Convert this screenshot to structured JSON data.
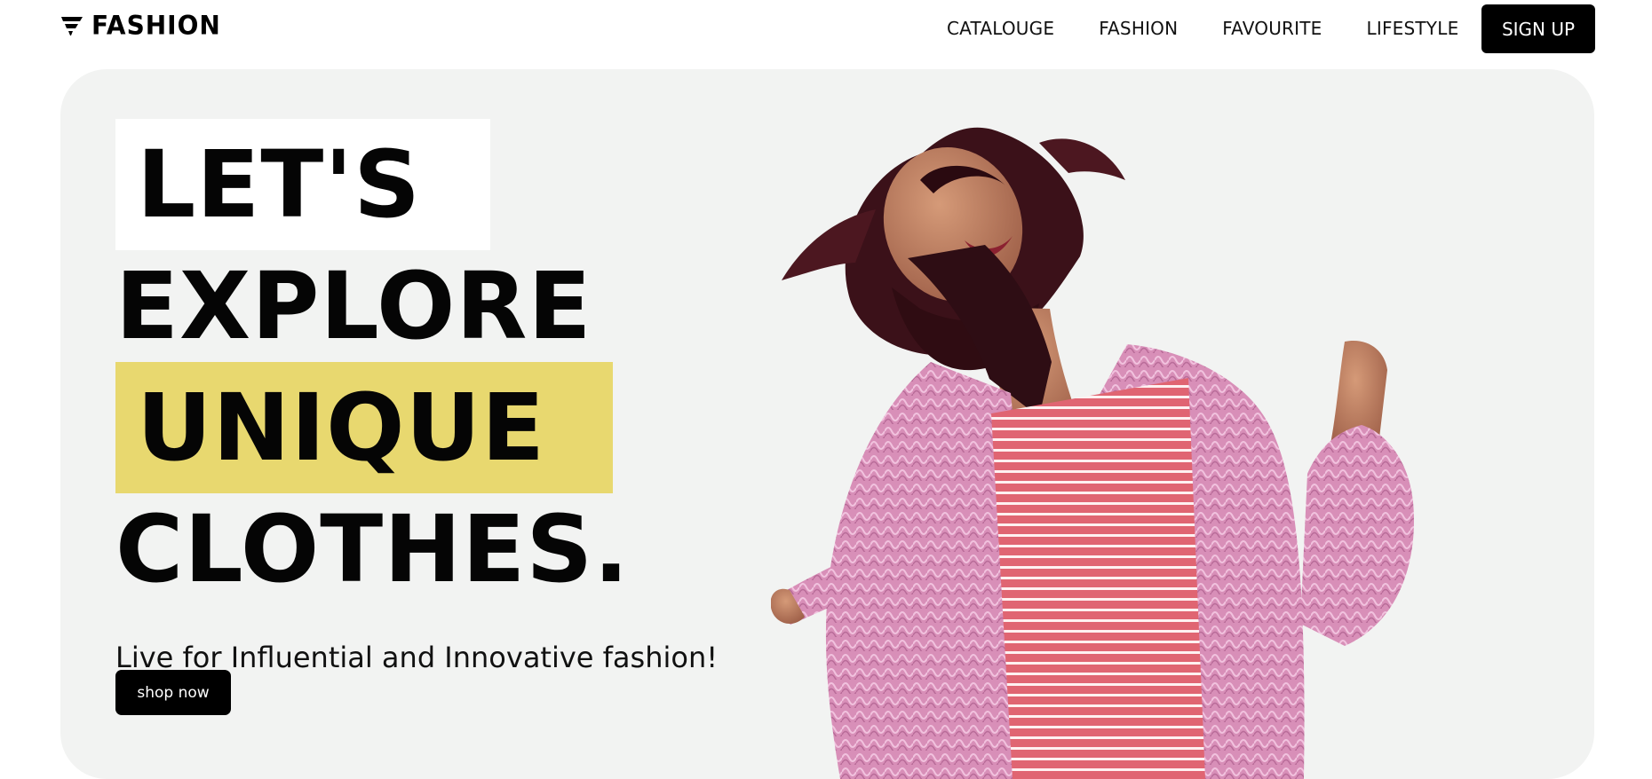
{
  "header": {
    "brand": "FASHION",
    "nav": [
      {
        "label": "CATALOUGE"
      },
      {
        "label": "FASHION"
      },
      {
        "label": "FAVOURITE"
      },
      {
        "label": "LIFESTYLE"
      }
    ],
    "signup_label": "SIGN UP"
  },
  "hero": {
    "headline": [
      "LET'S",
      "EXPLORE",
      "UNIQUE",
      "CLOTHES."
    ],
    "tagline": "Live for Influential and Innovative fashion!",
    "cta_label": "shop now",
    "image": "model-in-pink-fur-coat"
  },
  "colors": {
    "hero_background": "#f2f3f2",
    "highlight_yellow": "#e8d86f",
    "button_black": "#000000",
    "coat_pink": "#d88fb8",
    "dress_red": "#e06572"
  }
}
